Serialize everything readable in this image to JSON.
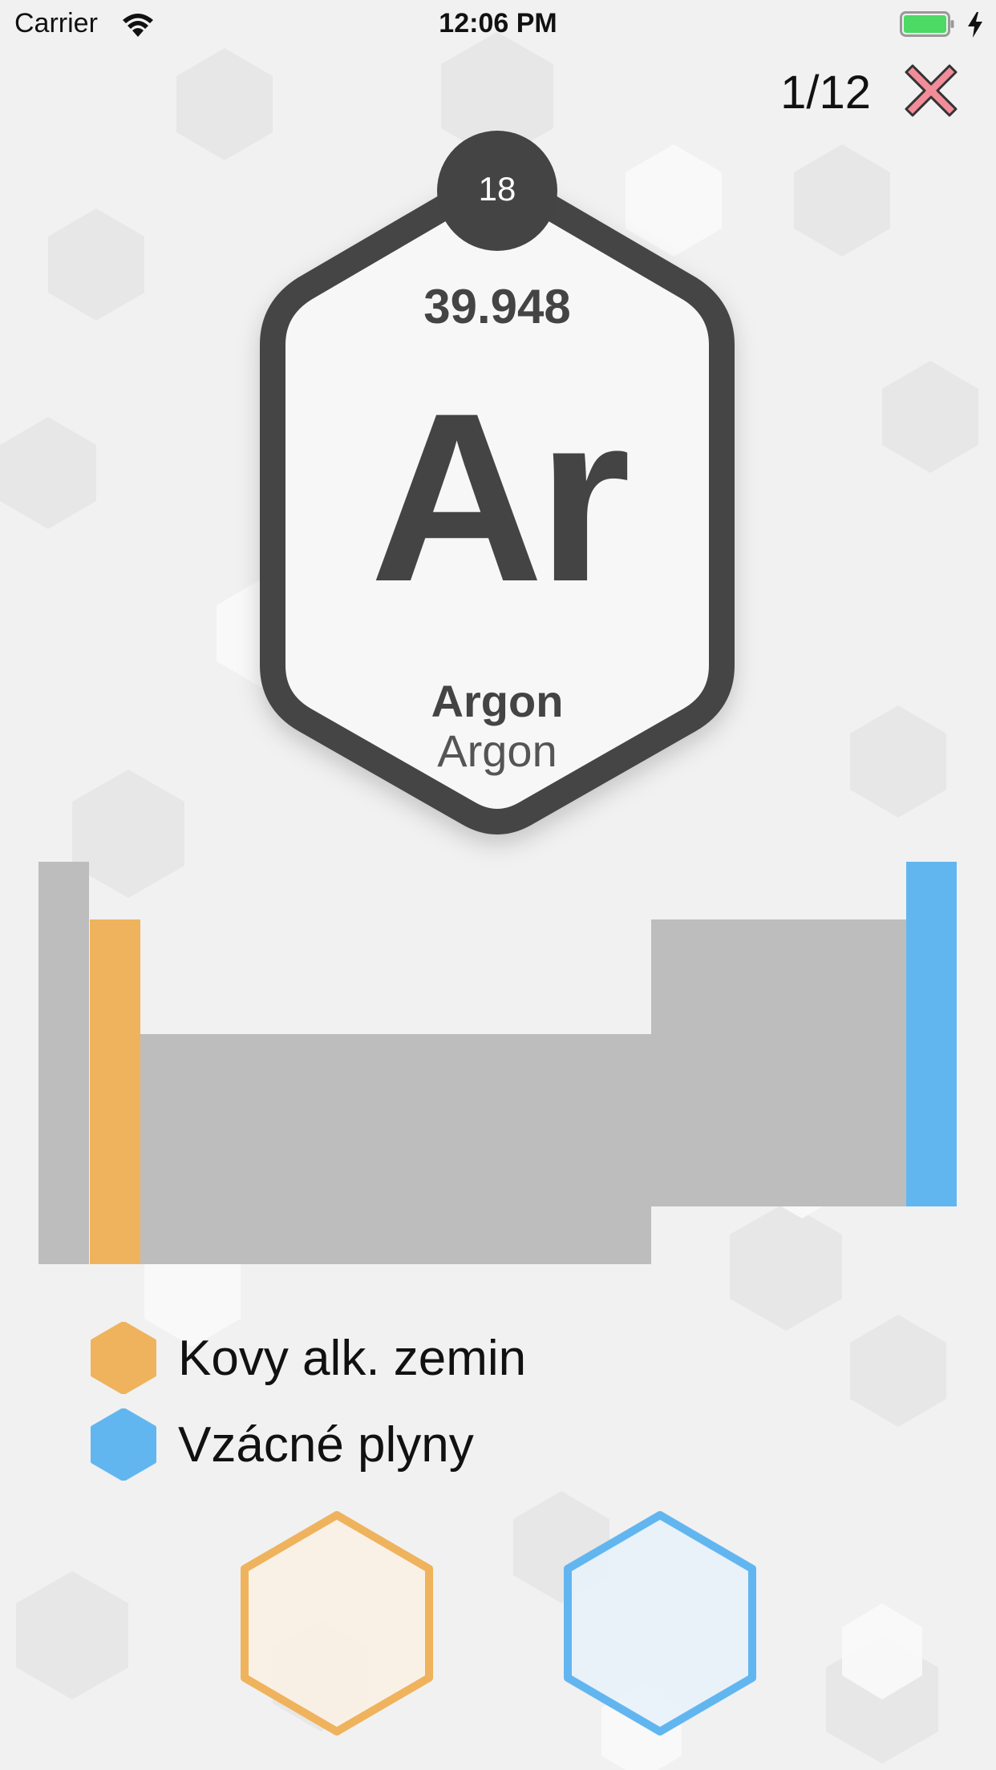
{
  "status_bar": {
    "carrier": "Carrier",
    "time": "12:06 PM",
    "battery_color": "#4cd964"
  },
  "quiz": {
    "progress": "1/12",
    "close_icon": "close-x-icon",
    "close_color": "#f18c98"
  },
  "element": {
    "atomic_number": "18",
    "atomic_mass": "39.948",
    "symbol": "Ar",
    "name_primary": "Argon",
    "name_secondary": "Argon"
  },
  "legend": [
    {
      "label": "Kovy alk. zemin",
      "color": "#efb35d",
      "icon": "hexagon-icon"
    },
    {
      "label": "Vzácné plyny",
      "color": "#62b6f0",
      "icon": "hexagon-icon"
    }
  ],
  "answers": [
    {
      "name": "alkaline-earth-answer",
      "color": "#efb35d"
    },
    {
      "name": "noble-gas-answer",
      "color": "#62b6f0"
    }
  ],
  "colors": {
    "dark": "#444444",
    "table_gray": "#bdbdbd",
    "orange": "#efb35d",
    "blue": "#62b6f0"
  }
}
